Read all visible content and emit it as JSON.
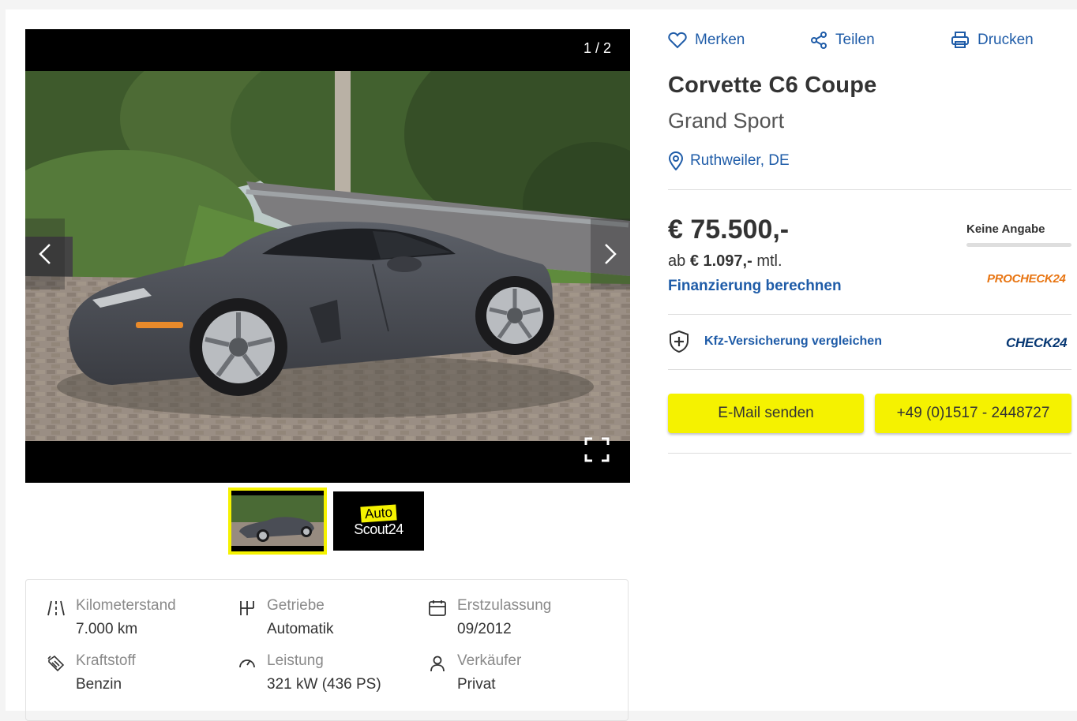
{
  "gallery": {
    "counter": "1 / 2",
    "thumbnail_logo": {
      "line1": "Auto",
      "line2": "Scout24"
    }
  },
  "actions": {
    "save": "Merken",
    "share": "Teilen",
    "print": "Drucken"
  },
  "listing": {
    "title": "Corvette C6 Coupe",
    "subtitle": "Grand Sport",
    "location": "Ruthweiler, DE"
  },
  "pricing": {
    "price": "€ 75.500,-",
    "monthly_prefix": "ab",
    "monthly_amount": "€ 1.097,-",
    "monthly_suffix": "mtl.",
    "finance_link": "Finanzierung berechnen",
    "rating_label": "Keine Angabe",
    "finance_partner": "PROCHECK24"
  },
  "insurance": {
    "link": "Kfz-Versicherung vergleichen",
    "partner": "CHECK24"
  },
  "contact": {
    "email_button": "E-Mail senden",
    "phone_button": "+49 (0)1517 - 2448727"
  },
  "specs": [
    {
      "icon": "road-icon",
      "label": "Kilometerstand",
      "value": "7.000 km"
    },
    {
      "icon": "gearbox-icon",
      "label": "Getriebe",
      "value": "Automatik"
    },
    {
      "icon": "calendar-icon",
      "label": "Erstzulassung",
      "value": "09/2012"
    },
    {
      "icon": "fuel-icon",
      "label": "Kraftstoff",
      "value": "Benzin"
    },
    {
      "icon": "speedometer-icon",
      "label": "Leistung",
      "value": "321 kW (436 PS)"
    },
    {
      "icon": "person-icon",
      "label": "Verkäufer",
      "value": "Privat"
    }
  ],
  "colors": {
    "brand_yellow": "#f5f200",
    "link_blue": "#1f5ca8",
    "car_body": "#4a4d55",
    "procheck_orange": "#e87512",
    "check24_navy": "#063773"
  }
}
